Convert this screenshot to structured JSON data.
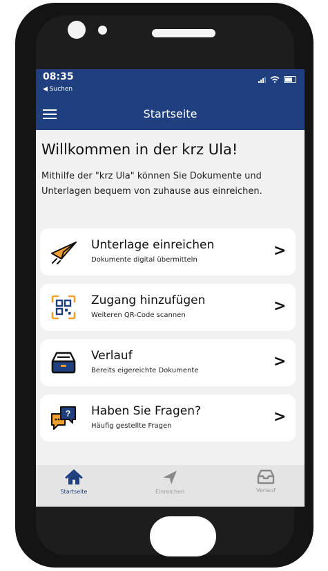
{
  "status": {
    "time": "08:35",
    "back_label": "Suchen"
  },
  "nav": {
    "title": "Startseite",
    "menu_icon": "hamburger-icon"
  },
  "welcome": {
    "heading": "Willkommen in der krz Ula!",
    "intro": "Mithilfe der \"krz Ula\" können Sie Dokumente und Unterlagen bequem von zuhause aus einreichen."
  },
  "menu": [
    {
      "icon": "paper-plane-icon",
      "title": "Unterlage einreichen",
      "subtitle": "Dokumente digital übermitteln"
    },
    {
      "icon": "qr-code-icon",
      "title": "Zugang hinzufügen",
      "subtitle": "Weiteren QR-Code scannen"
    },
    {
      "icon": "inbox-tray-icon",
      "title": "Verlauf",
      "subtitle": "Bereits eigereichte Dokumente"
    },
    {
      "icon": "chat-question-icon",
      "title": "Haben Sie Fragen?",
      "subtitle": "Häufig gestellte Fragen"
    }
  ],
  "tabs": [
    {
      "icon": "home-icon",
      "label": "Startseite",
      "active": true
    },
    {
      "icon": "paper-plane-icon",
      "label": "Einreichen",
      "active": false
    },
    {
      "icon": "inbox-icon",
      "label": "Verlauf",
      "active": false
    }
  ],
  "colors": {
    "brand": "#1f3f7e",
    "accent": "#f0a030",
    "background": "#f1f1f1"
  }
}
